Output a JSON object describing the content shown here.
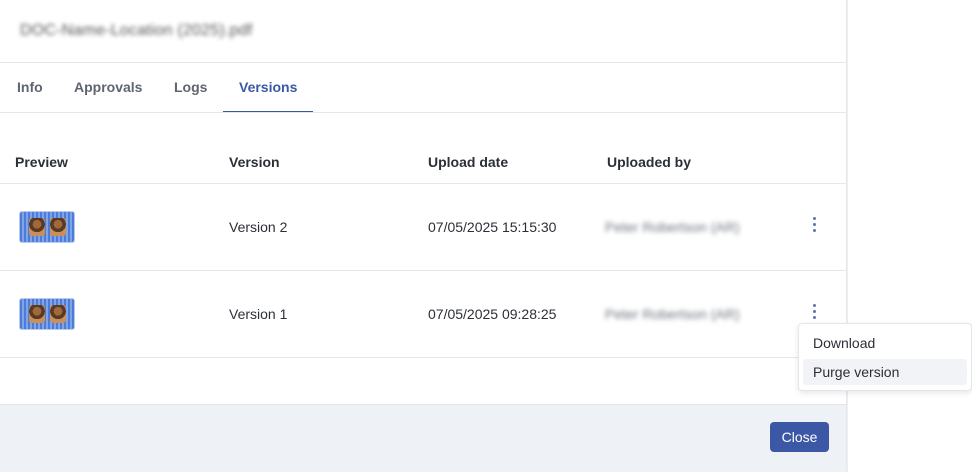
{
  "modal": {
    "title": "DOC-Name-Location (2025).pdf"
  },
  "tabs": [
    {
      "label": "Info",
      "active": false
    },
    {
      "label": "Approvals",
      "active": false
    },
    {
      "label": "Logs",
      "active": false
    },
    {
      "label": "Versions",
      "active": true
    }
  ],
  "table": {
    "headers": [
      "Preview",
      "Version",
      "Upload date",
      "Uploaded by"
    ],
    "rows": [
      {
        "version": "Version 2",
        "upload_date": "07/05/2025 15:15:30",
        "uploaded_by": "Peter Robertson (AR)"
      },
      {
        "version": "Version 1",
        "upload_date": "07/05/2025 09:28:25",
        "uploaded_by": "Peter Robertson (AR)"
      }
    ]
  },
  "menu": {
    "items": [
      "Download",
      "Purge version"
    ],
    "hovered": "Purge version"
  },
  "footer": {
    "close_label": "Close"
  },
  "colors": {
    "accent": "#3b57a6",
    "footer_bg": "#eef1f6"
  }
}
